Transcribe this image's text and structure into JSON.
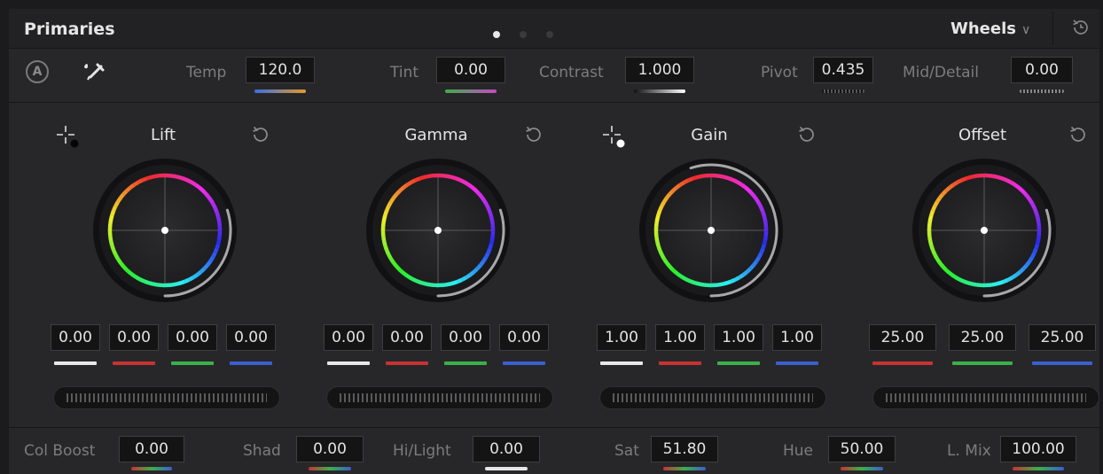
{
  "header": {
    "title": "Primaries",
    "page_dots": 3,
    "active_dot": 0,
    "mode_label": "Wheels"
  },
  "toolbar": {
    "auto_label": "A",
    "params": [
      {
        "label": "Temp",
        "value": "120.0"
      },
      {
        "label": "Tint",
        "value": "0.00"
      },
      {
        "label": "Contrast",
        "value": "1.000"
      },
      {
        "label": "Pivot",
        "value": "0.435"
      },
      {
        "label": "Mid/Detail",
        "value": "0.00"
      }
    ]
  },
  "wheels": [
    {
      "name": "Lift",
      "values": [
        "0.00",
        "0.00",
        "0.00",
        "0.00"
      ],
      "channels": [
        "white",
        "red",
        "green",
        "blue"
      ],
      "ring_level": 0.3,
      "picker_color": "black"
    },
    {
      "name": "Gamma",
      "values": [
        "0.00",
        "0.00",
        "0.00",
        "0.00"
      ],
      "channels": [
        "white",
        "red",
        "green",
        "blue"
      ],
      "ring_level": 0.3,
      "picker_color": "none"
    },
    {
      "name": "Gain",
      "values": [
        "1.00",
        "1.00",
        "1.00",
        "1.00"
      ],
      "channels": [
        "white",
        "red",
        "green",
        "blue"
      ],
      "ring_level": 0.55,
      "picker_color": "white"
    },
    {
      "name": "Offset",
      "values": [
        "25.00",
        "25.00",
        "25.00"
      ],
      "channels": [
        "red",
        "green",
        "blue"
      ],
      "ring_level": 0.3,
      "picker_color": "none"
    }
  ],
  "bottom": {
    "params": [
      {
        "label": "Col Boost",
        "value": "0.00"
      },
      {
        "label": "Shad",
        "value": "0.00"
      },
      {
        "label": "Hi/Light",
        "value": "0.00"
      },
      {
        "label": "Sat",
        "value": "51.80"
      },
      {
        "label": "Hue",
        "value": "50.00"
      },
      {
        "label": "L. Mix",
        "value": "100.00"
      }
    ]
  },
  "colors": {
    "panel_bg": "#27272a",
    "value_box_bg": "#141415",
    "white_channel": "#e8e8e8",
    "red_channel": "#c83232",
    "green_channel": "#3cb048",
    "blue_channel": "#3a5fd0"
  },
  "icons": {
    "auto_balance": "circle-a-icon",
    "picker": "eyedropper-icon",
    "reset": "reset-icon",
    "crosshair": "crosshair-icon",
    "history": "history-icon",
    "dropdown": "chevron-down-icon"
  }
}
